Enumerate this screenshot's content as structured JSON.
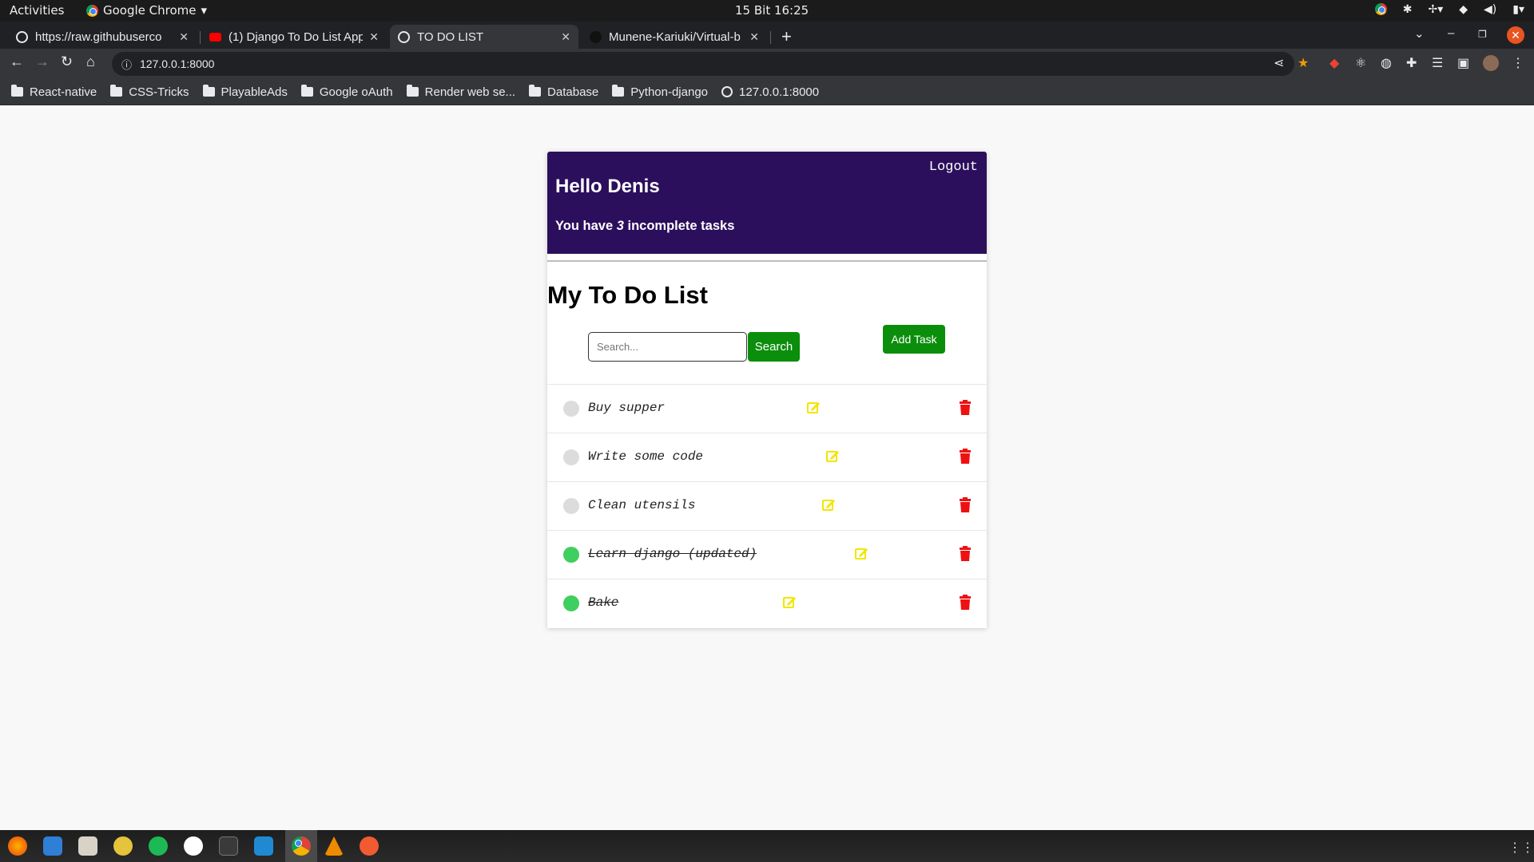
{
  "system_bar": {
    "activities": "Activities",
    "app_name": "Google Chrome",
    "clock": "15 Bit  16:25"
  },
  "browser": {
    "tabs": [
      {
        "title": "https://raw.githubuserco",
        "favicon": "globe-icon"
      },
      {
        "title": "(1) Django To Do List App",
        "favicon": "youtube-icon"
      },
      {
        "title": "TO DO LIST",
        "favicon": "globe-icon",
        "active": true
      },
      {
        "title": "Munene-Kariuki/Virtual-b",
        "favicon": "github-icon"
      }
    ],
    "address": "127.0.0.1:8000",
    "bookmarks": [
      {
        "label": "React-native",
        "icon": "folder-icon"
      },
      {
        "label": "CSS-Tricks",
        "icon": "folder-icon"
      },
      {
        "label": "PlayableAds",
        "icon": "folder-icon"
      },
      {
        "label": "Google oAuth",
        "icon": "folder-icon"
      },
      {
        "label": "Render web se...",
        "icon": "folder-icon"
      },
      {
        "label": "Database",
        "icon": "folder-icon"
      },
      {
        "label": "Python-django",
        "icon": "folder-icon"
      },
      {
        "label": "127.0.0.1:8000",
        "icon": "globe-icon"
      }
    ]
  },
  "page": {
    "header": {
      "logout": "Logout",
      "greeting": "Hello Denis",
      "count_prefix": "You have ",
      "count_value": "3",
      "count_suffix": " incomplete tasks"
    },
    "list_title": "My To Do List",
    "search": {
      "placeholder": "Search...",
      "button": "Search"
    },
    "add_task": "Add Task",
    "tasks": [
      {
        "title": "Buy supper",
        "complete": false
      },
      {
        "title": "Write some code",
        "complete": false
      },
      {
        "title": "Clean utensils",
        "complete": false
      },
      {
        "title": "Learn django (updated)",
        "complete": true
      },
      {
        "title": "Bake",
        "complete": true
      }
    ]
  },
  "colors": {
    "header_bg": "#2c0f5c",
    "button_green": "#0b8e0b",
    "complete_dot": "#3ecf5e",
    "incomplete_dot": "#dcdcdc",
    "edit_icon": "#f2e600",
    "delete_icon": "#ee1111"
  }
}
